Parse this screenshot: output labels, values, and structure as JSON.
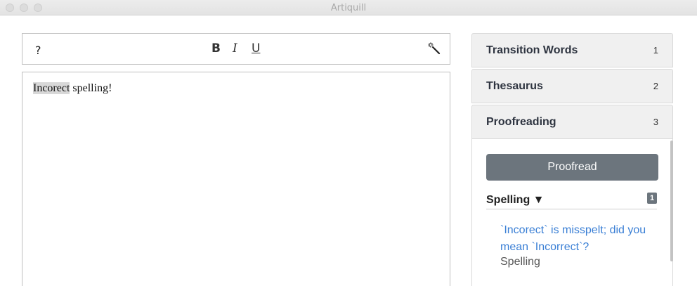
{
  "window": {
    "title": "Artiquill"
  },
  "toolbar": {
    "help_label": "?",
    "bold_label": "B",
    "italic_label": "I",
    "underline_label": "U",
    "wand_icon": "magic-wand-icon"
  },
  "editor": {
    "highlighted_word": "Incorect",
    "rest_text": " spelling!"
  },
  "sidebar": {
    "items": [
      {
        "label": "Transition Words",
        "number": "1"
      },
      {
        "label": "Thesaurus",
        "number": "2"
      },
      {
        "label": "Proofreading",
        "number": "3"
      }
    ],
    "proofreading": {
      "button_label": "Proofread",
      "section_title": "Spelling ▼",
      "section_count": "1",
      "issues": [
        {
          "message": "`Incorect` is misspelt; did you mean `Incorrect`?",
          "type": "Spelling"
        }
      ]
    }
  },
  "colors": {
    "button_gray": "#6c757d",
    "link_blue": "#3a7fd5",
    "accordion_bg": "#f0f0f0"
  }
}
